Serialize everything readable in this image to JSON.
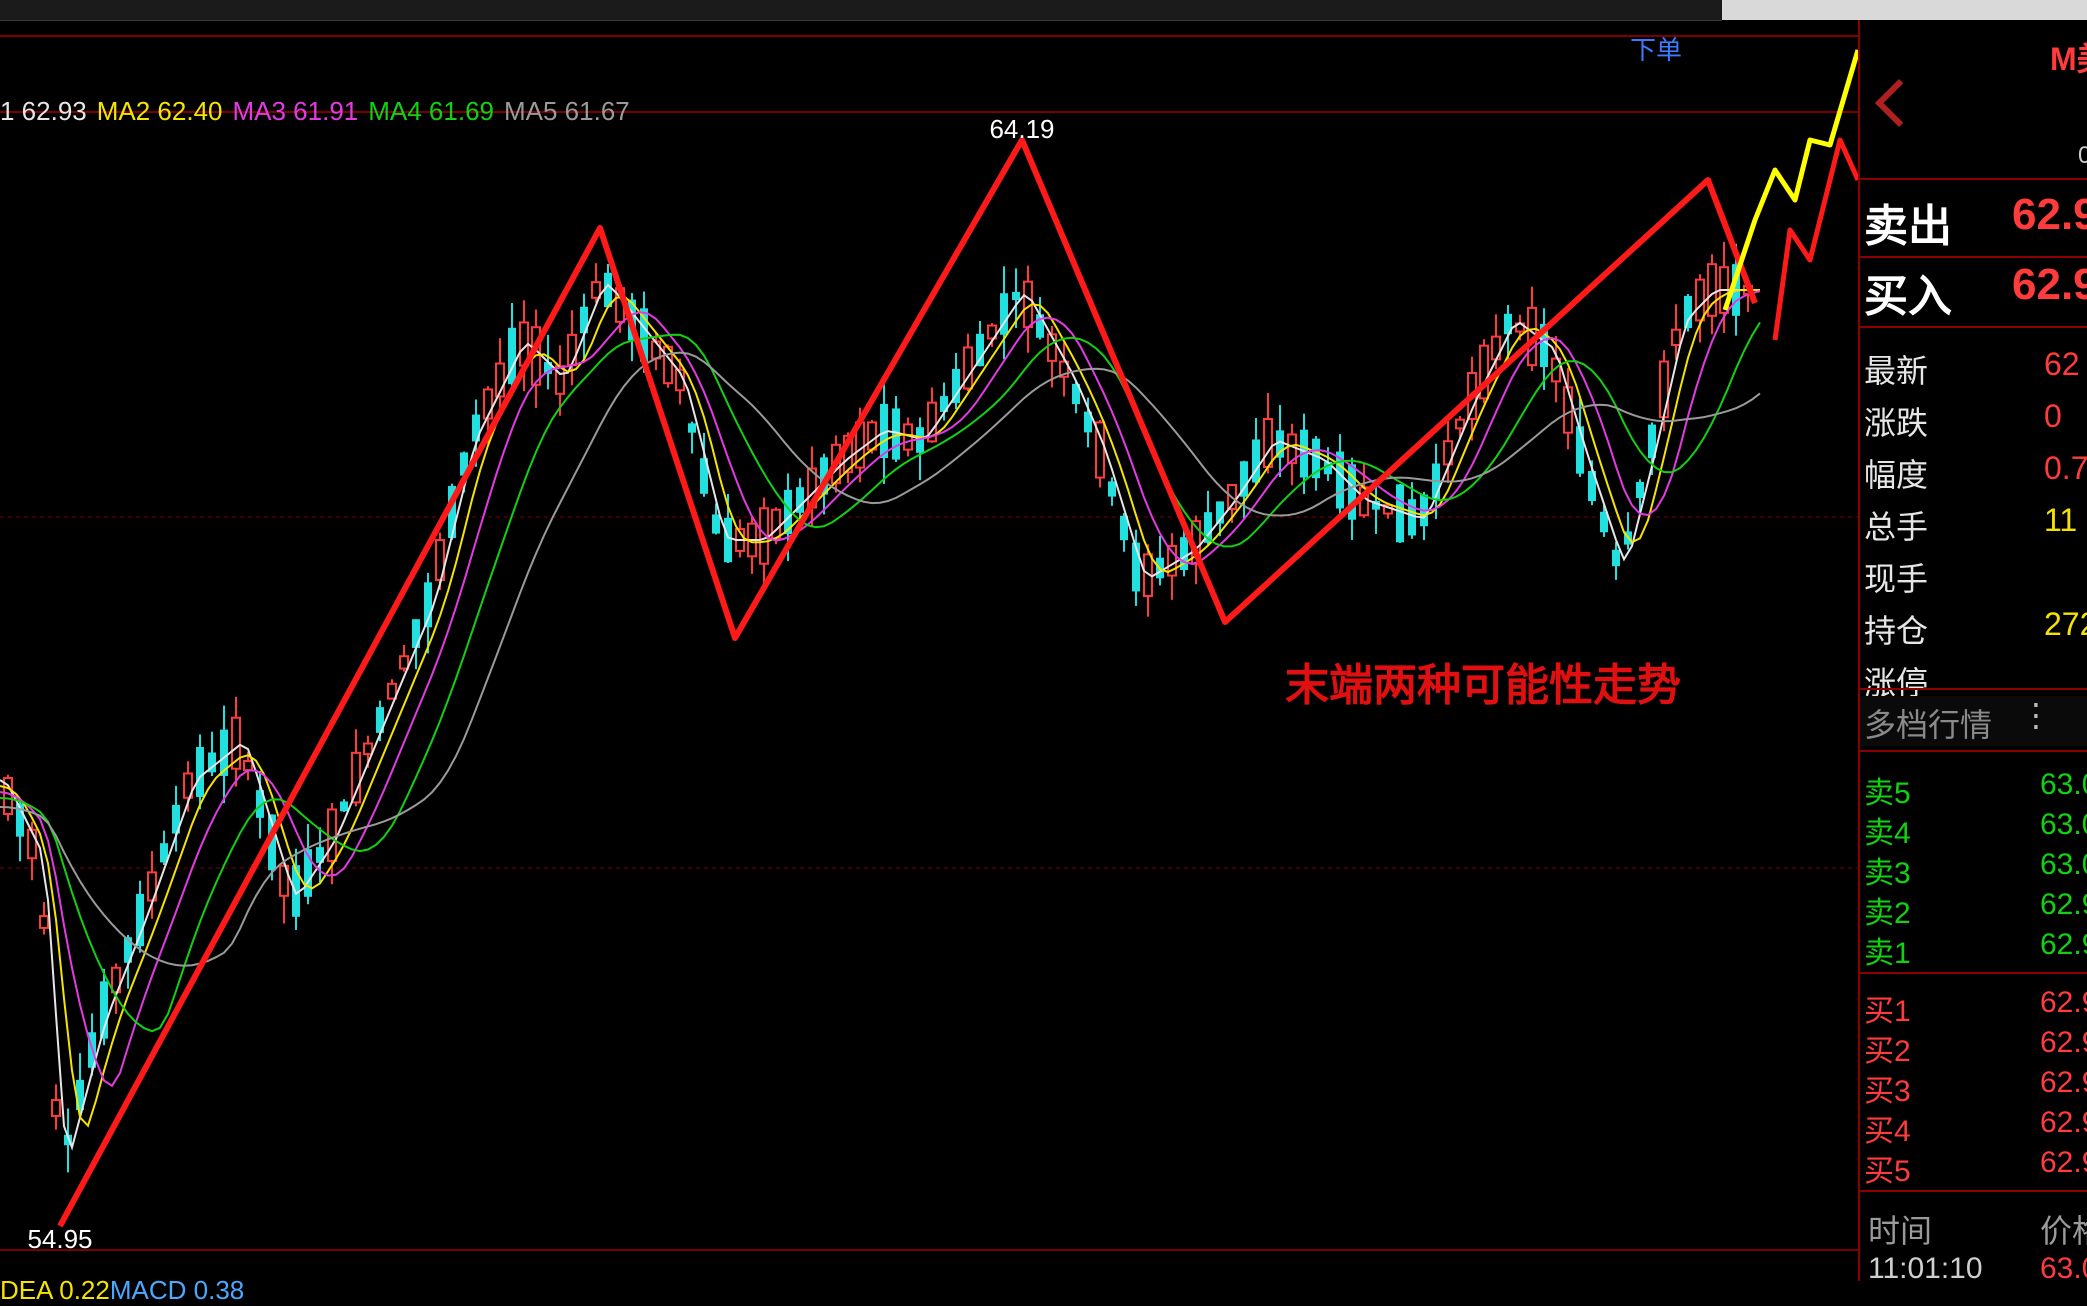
{
  "toolbar": {
    "order_link": "下单"
  },
  "ma_legend": [
    {
      "label": "1 62.93",
      "color": "#e6e6e6"
    },
    {
      "label": "MA2 62.40",
      "color": "#f5e400"
    },
    {
      "label": "MA3 61.91",
      "color": "#e23be2"
    },
    {
      "label": "MA4 61.69",
      "color": "#12d112"
    },
    {
      "label": "MA5 61.67",
      "color": "#9a9a9a"
    }
  ],
  "macd_legend": [
    {
      "label": "DEA 0.22",
      "color": "#f5e400"
    },
    {
      "label": "MACD 0.38",
      "color": "#4aa8ff"
    }
  ],
  "chart": {
    "high_label": "64.19",
    "low_label": "54.95",
    "annotation": "末端两种可能性走势"
  },
  "panel": {
    "top_label": "M美",
    "top_sub": "0",
    "sell_label": "卖出",
    "sell_value": "62.9",
    "buy_label": "买入",
    "buy_value": "62.9",
    "stats": [
      {
        "label": "最新",
        "value": "62",
        "color": "#ff3b3b"
      },
      {
        "label": "涨跌",
        "value": "0",
        "color": "#ff3b3b"
      },
      {
        "label": "幅度",
        "value": "0.7",
        "color": "#ff3b3b"
      },
      {
        "label": "总手",
        "value": "11",
        "color": "#f5e400"
      },
      {
        "label": "现手",
        "value": "",
        "color": "#f5e400"
      },
      {
        "label": "持仓",
        "value": "272",
        "color": "#f5e400"
      },
      {
        "label": "涨停",
        "value": "",
        "color": "#ff3b3b"
      }
    ],
    "depth_title": "多档行情",
    "asks": [
      {
        "label": "卖5",
        "price": "63.0"
      },
      {
        "label": "卖4",
        "price": "63.0"
      },
      {
        "label": "卖3",
        "price": "63.0"
      },
      {
        "label": "卖2",
        "price": "62.9"
      },
      {
        "label": "卖1",
        "price": "62.9"
      }
    ],
    "bids": [
      {
        "label": "买1",
        "price": "62.9"
      },
      {
        "label": "买2",
        "price": "62.9"
      },
      {
        "label": "买3",
        "price": "62.9"
      },
      {
        "label": "买4",
        "price": "62.9"
      },
      {
        "label": "买5",
        "price": "62.9"
      }
    ],
    "ticks_header": {
      "time": "时间",
      "price": "价格"
    },
    "ticks": [
      {
        "time": "11:01:10",
        "price": "63.0"
      }
    ]
  }
}
